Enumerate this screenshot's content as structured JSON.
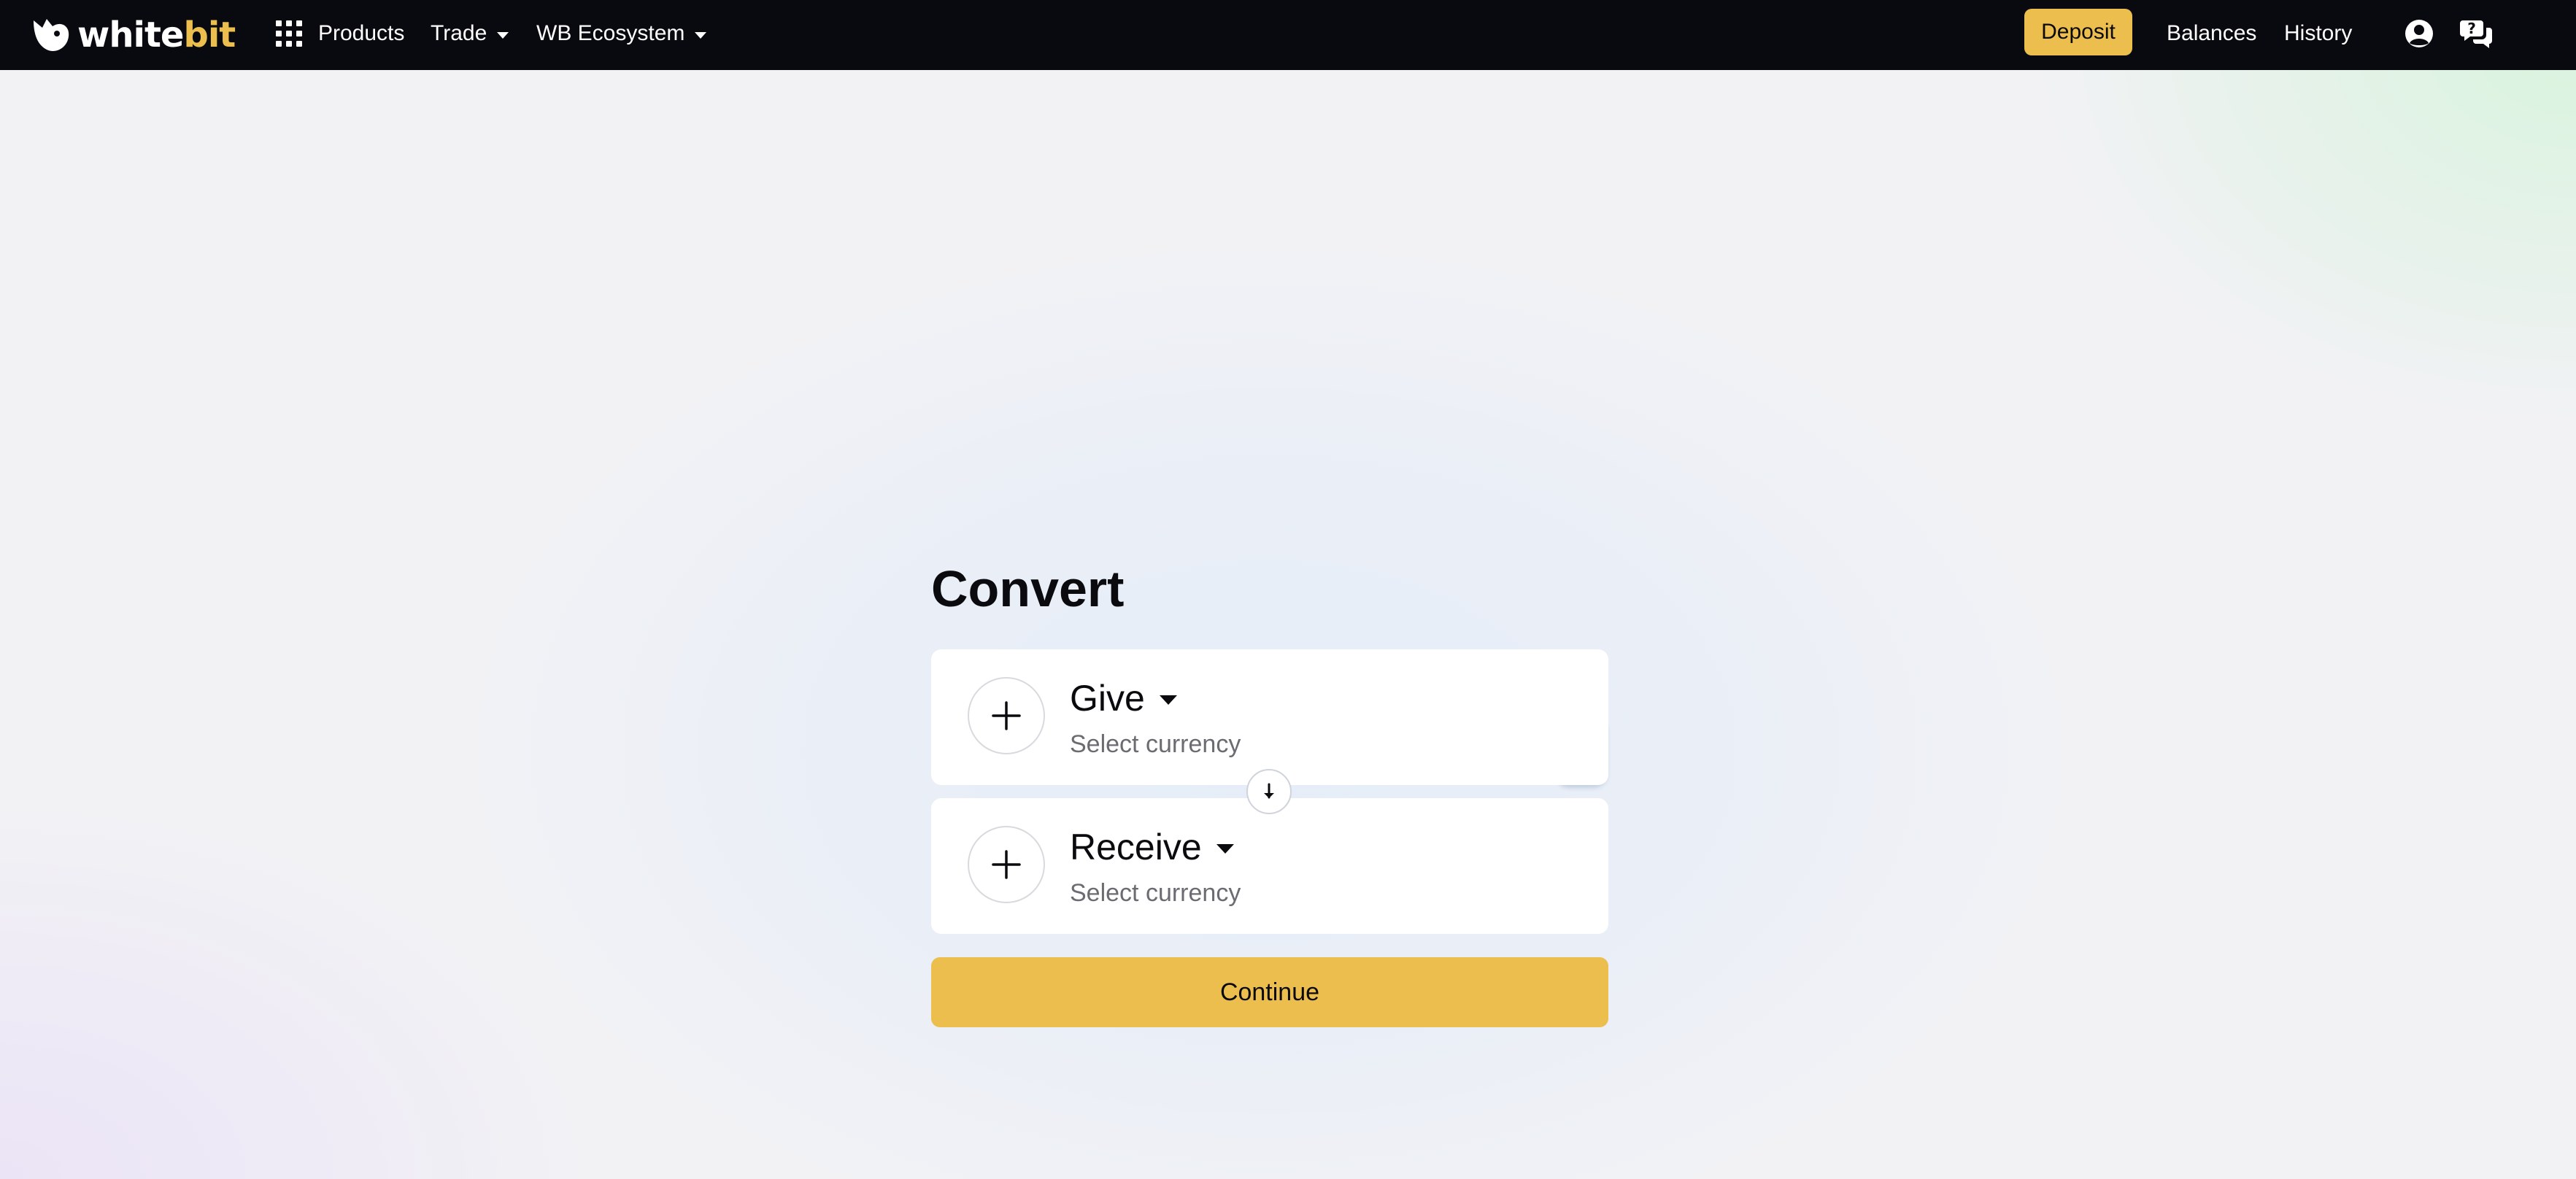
{
  "brand": {
    "name_part1": "white",
    "name_part2": "bit",
    "accent_color": "#ebbe4d",
    "header_bg": "#090a10"
  },
  "nav": {
    "products": {
      "label": "Products",
      "icon": "grid-icon"
    },
    "trade": {
      "label": "Trade",
      "icon": "caret-down-icon"
    },
    "ecosystem": {
      "label": "WB Ecosystem",
      "icon": "caret-down-icon"
    },
    "deposit": "Deposit",
    "balances": "Balances",
    "history": "History",
    "account_icon": "user-circle-icon",
    "support_icon": "help-chat-icon"
  },
  "convert": {
    "title": "Convert",
    "give": {
      "label": "Give",
      "placeholder": "Select currency",
      "icon": "plus-icon"
    },
    "receive": {
      "label": "Receive",
      "placeholder": "Select currency",
      "icon": "plus-icon"
    },
    "swap_icon": "arrow-down-icon",
    "continue_label": "Continue"
  }
}
